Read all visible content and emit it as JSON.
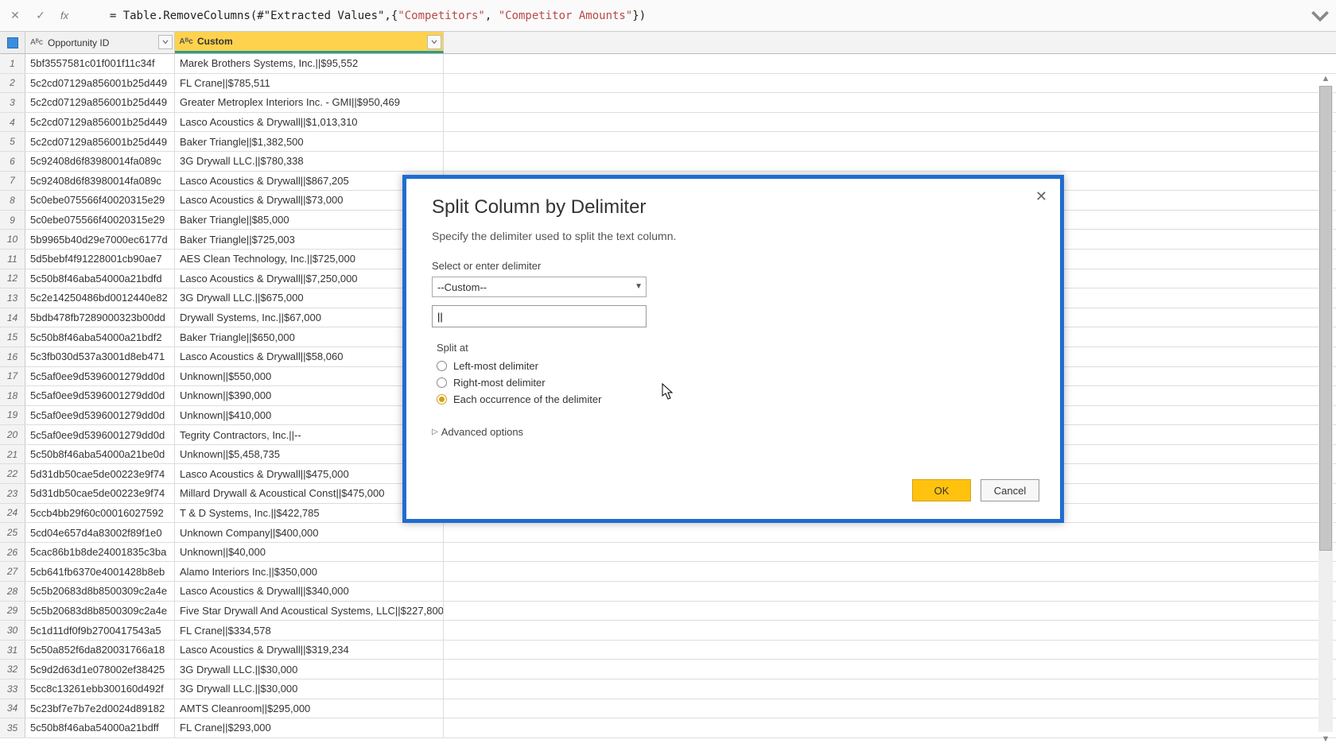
{
  "formula_bar": {
    "fx": "fx",
    "prefix": "= Table.RemoveColumns(#\"Extracted Values\",{",
    "q1": "\"Competitors\"",
    "mid": ", ",
    "q2": "\"Competitor Amounts\"",
    "suffix": "})"
  },
  "columns": {
    "opportunity": "Opportunity ID",
    "custom": "Custom"
  },
  "rows": [
    {
      "n": "1",
      "id": "5bf3557581c01f001f11c34f",
      "val": "Marek Brothers Systems, Inc.||$95,552"
    },
    {
      "n": "2",
      "id": "5c2cd07129a856001b25d449",
      "val": "FL Crane||$785,511"
    },
    {
      "n": "3",
      "id": "5c2cd07129a856001b25d449",
      "val": "Greater Metroplex Interiors  Inc. - GMI||$950,469"
    },
    {
      "n": "4",
      "id": "5c2cd07129a856001b25d449",
      "val": "Lasco Acoustics & Drywall||$1,013,310"
    },
    {
      "n": "5",
      "id": "5c2cd07129a856001b25d449",
      "val": "Baker Triangle||$1,382,500"
    },
    {
      "n": "6",
      "id": "5c92408d6f83980014fa089c",
      "val": "3G Drywall LLC.||$780,338"
    },
    {
      "n": "7",
      "id": "5c92408d6f83980014fa089c",
      "val": "Lasco Acoustics & Drywall||$867,205"
    },
    {
      "n": "8",
      "id": "5c0ebe075566f40020315e29",
      "val": "Lasco Acoustics & Drywall||$73,000"
    },
    {
      "n": "9",
      "id": "5c0ebe075566f40020315e29",
      "val": "Baker Triangle||$85,000"
    },
    {
      "n": "10",
      "id": "5b9965b40d29e7000ec6177d",
      "val": "Baker Triangle||$725,003"
    },
    {
      "n": "11",
      "id": "5d5bebf4f91228001cb90ae7",
      "val": "AES Clean Technology, Inc.||$725,000"
    },
    {
      "n": "12",
      "id": "5c50b8f46aba54000a21bdfd",
      "val": "Lasco Acoustics & Drywall||$7,250,000"
    },
    {
      "n": "13",
      "id": "5c2e14250486bd0012440e82",
      "val": "3G Drywall LLC.||$675,000"
    },
    {
      "n": "14",
      "id": "5bdb478fb7289000323b00dd",
      "val": "Drywall Systems, Inc.||$67,000"
    },
    {
      "n": "15",
      "id": "5c50b8f46aba54000a21bdf2",
      "val": "Baker Triangle||$650,000"
    },
    {
      "n": "16",
      "id": "5c3fb030d537a3001d8eb471",
      "val": "Lasco Acoustics & Drywall||$58,060"
    },
    {
      "n": "17",
      "id": "5c5af0ee9d5396001279dd0d",
      "val": "Unknown||$550,000"
    },
    {
      "n": "18",
      "id": "5c5af0ee9d5396001279dd0d",
      "val": "Unknown||$390,000"
    },
    {
      "n": "19",
      "id": "5c5af0ee9d5396001279dd0d",
      "val": "Unknown||$410,000"
    },
    {
      "n": "20",
      "id": "5c5af0ee9d5396001279dd0d",
      "val": "Tegrity Contractors, Inc.||--"
    },
    {
      "n": "21",
      "id": "5c50b8f46aba54000a21be0d",
      "val": "Unknown||$5,458,735"
    },
    {
      "n": "22",
      "id": "5d31db50cae5de00223e9f74",
      "val": "Lasco Acoustics & Drywall||$475,000"
    },
    {
      "n": "23",
      "id": "5d31db50cae5de00223e9f74",
      "val": "Millard Drywall & Acoustical Const||$475,000"
    },
    {
      "n": "24",
      "id": "5ccb4bb29f60c00016027592",
      "val": "T & D Systems, Inc.||$422,785"
    },
    {
      "n": "25",
      "id": "5cd04e657d4a83002f89f1e0",
      "val": "Unknown Company||$400,000"
    },
    {
      "n": "26",
      "id": "5cac86b1b8de24001835c3ba",
      "val": "Unknown||$40,000"
    },
    {
      "n": "27",
      "id": "5cb641fb6370e4001428b8eb",
      "val": "Alamo Interiors Inc.||$350,000"
    },
    {
      "n": "28",
      "id": "5c5b20683d8b8500309c2a4e",
      "val": "Lasco Acoustics & Drywall||$340,000"
    },
    {
      "n": "29",
      "id": "5c5b20683d8b8500309c2a4e",
      "val": "Five Star Drywall And Acoustical Systems, LLC||$227,800"
    },
    {
      "n": "30",
      "id": "5c1d11df0f9b2700417543a5",
      "val": "FL Crane||$334,578"
    },
    {
      "n": "31",
      "id": "5c50a852f6da820031766a18",
      "val": "Lasco Acoustics & Drywall||$319,234"
    },
    {
      "n": "32",
      "id": "5c9d2d63d1e078002ef38425",
      "val": "3G Drywall LLC.||$30,000"
    },
    {
      "n": "33",
      "id": "5cc8c13261ebb300160d492f",
      "val": "3G Drywall LLC.||$30,000"
    },
    {
      "n": "34",
      "id": "5c23bf7e7b7e2d0024d89182",
      "val": "AMTS Cleanroom||$295,000"
    },
    {
      "n": "35",
      "id": "5c50b8f46aba54000a21bdff",
      "val": "FL Crane||$293,000"
    }
  ],
  "dialog": {
    "title": "Split Column by Delimiter",
    "subtitle": "Specify the delimiter used to split the text column.",
    "select_label": "Select or enter delimiter",
    "select_value": "--Custom--",
    "delimiter_value": "||",
    "split_at": "Split at",
    "opt_left": "Left-most delimiter",
    "opt_right": "Right-most delimiter",
    "opt_each": "Each occurrence of the delimiter",
    "advanced": "Advanced options",
    "ok": "OK",
    "cancel": "Cancel"
  }
}
